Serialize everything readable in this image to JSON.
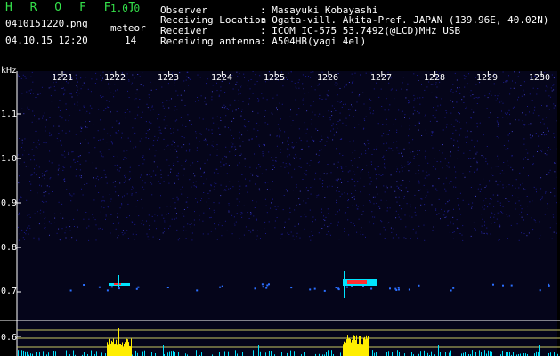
{
  "app": {
    "title": "H R O F F T",
    "version": "1.0.0"
  },
  "file": {
    "name": "0410151220.png",
    "datetime": "04.10.15 12:20"
  },
  "meteor": {
    "label": "meteor",
    "count": "14"
  },
  "station": [
    {
      "label": "Observer",
      "value": ": Masayuki Kobayashi"
    },
    {
      "label": "Receiving Location",
      "value": ": Ogata-vill. Akita-Pref. JAPAN (139.96E, 40.02N)"
    },
    {
      "label": "Receiver",
      "value": ": ICOM IC-575 53.7492(@LCD)MHz USB"
    },
    {
      "label": "Receiving antenna",
      "value": ": A504HB(yagi 4el)"
    }
  ],
  "axes": {
    "y_unit": "kHz",
    "x_ticks": [
      "1221",
      "1222",
      "1223",
      "1224",
      "1225",
      "1226",
      "1227",
      "1228",
      "1229",
      "1230"
    ],
    "y_ticks": [
      "1.1",
      "1.0",
      "0.9",
      "0.8",
      "0.7",
      "0.6"
    ]
  },
  "colors": {
    "accent_green": "#34e04a",
    "noise": "#1a1a8a",
    "signal": "#00e5ff",
    "hot": "#ffee00"
  }
}
